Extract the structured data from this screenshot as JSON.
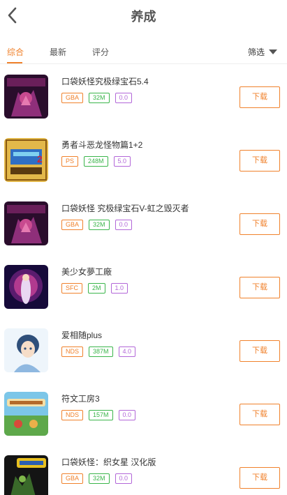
{
  "header": {
    "title": "养成",
    "back_icon": "chevron-left-icon"
  },
  "tabs": [
    {
      "label": "综合",
      "active": true
    },
    {
      "label": "最新",
      "active": false
    },
    {
      "label": "评分",
      "active": false
    }
  ],
  "filter": {
    "label": "筛选",
    "icon": "triangle-down-icon"
  },
  "colors": {
    "accent": "#f0812b",
    "size_tag": "#3ab54a",
    "rating_tag": "#b266d8"
  },
  "games": [
    {
      "name": "口袋妖怪究极绿宝石5.4",
      "platform": "GBA",
      "size": "32M",
      "rating": "0.0",
      "download": "下载"
    },
    {
      "name": "勇者斗恶龙怪物篇1+2",
      "platform": "PS",
      "size": "248M",
      "rating": "5.0",
      "download": "下载"
    },
    {
      "name": "口袋妖怪 究极绿宝石V-虹之毁灭者",
      "platform": "GBA",
      "size": "32M",
      "rating": "0.0",
      "download": "下载"
    },
    {
      "name": "美少女夢工廠",
      "platform": "SFC",
      "size": "2M",
      "rating": "1.0",
      "download": "下载"
    },
    {
      "name": "爱相随plus",
      "platform": "NDS",
      "size": "387M",
      "rating": "4.0",
      "download": "下载"
    },
    {
      "name": "符文工房3",
      "platform": "NDS",
      "size": "157M",
      "rating": "0.0",
      "download": "下载"
    },
    {
      "name": "口袋妖怪：织女星 汉化版",
      "platform": "GBA",
      "size": "32M",
      "rating": "0.0",
      "download": "下载"
    }
  ]
}
